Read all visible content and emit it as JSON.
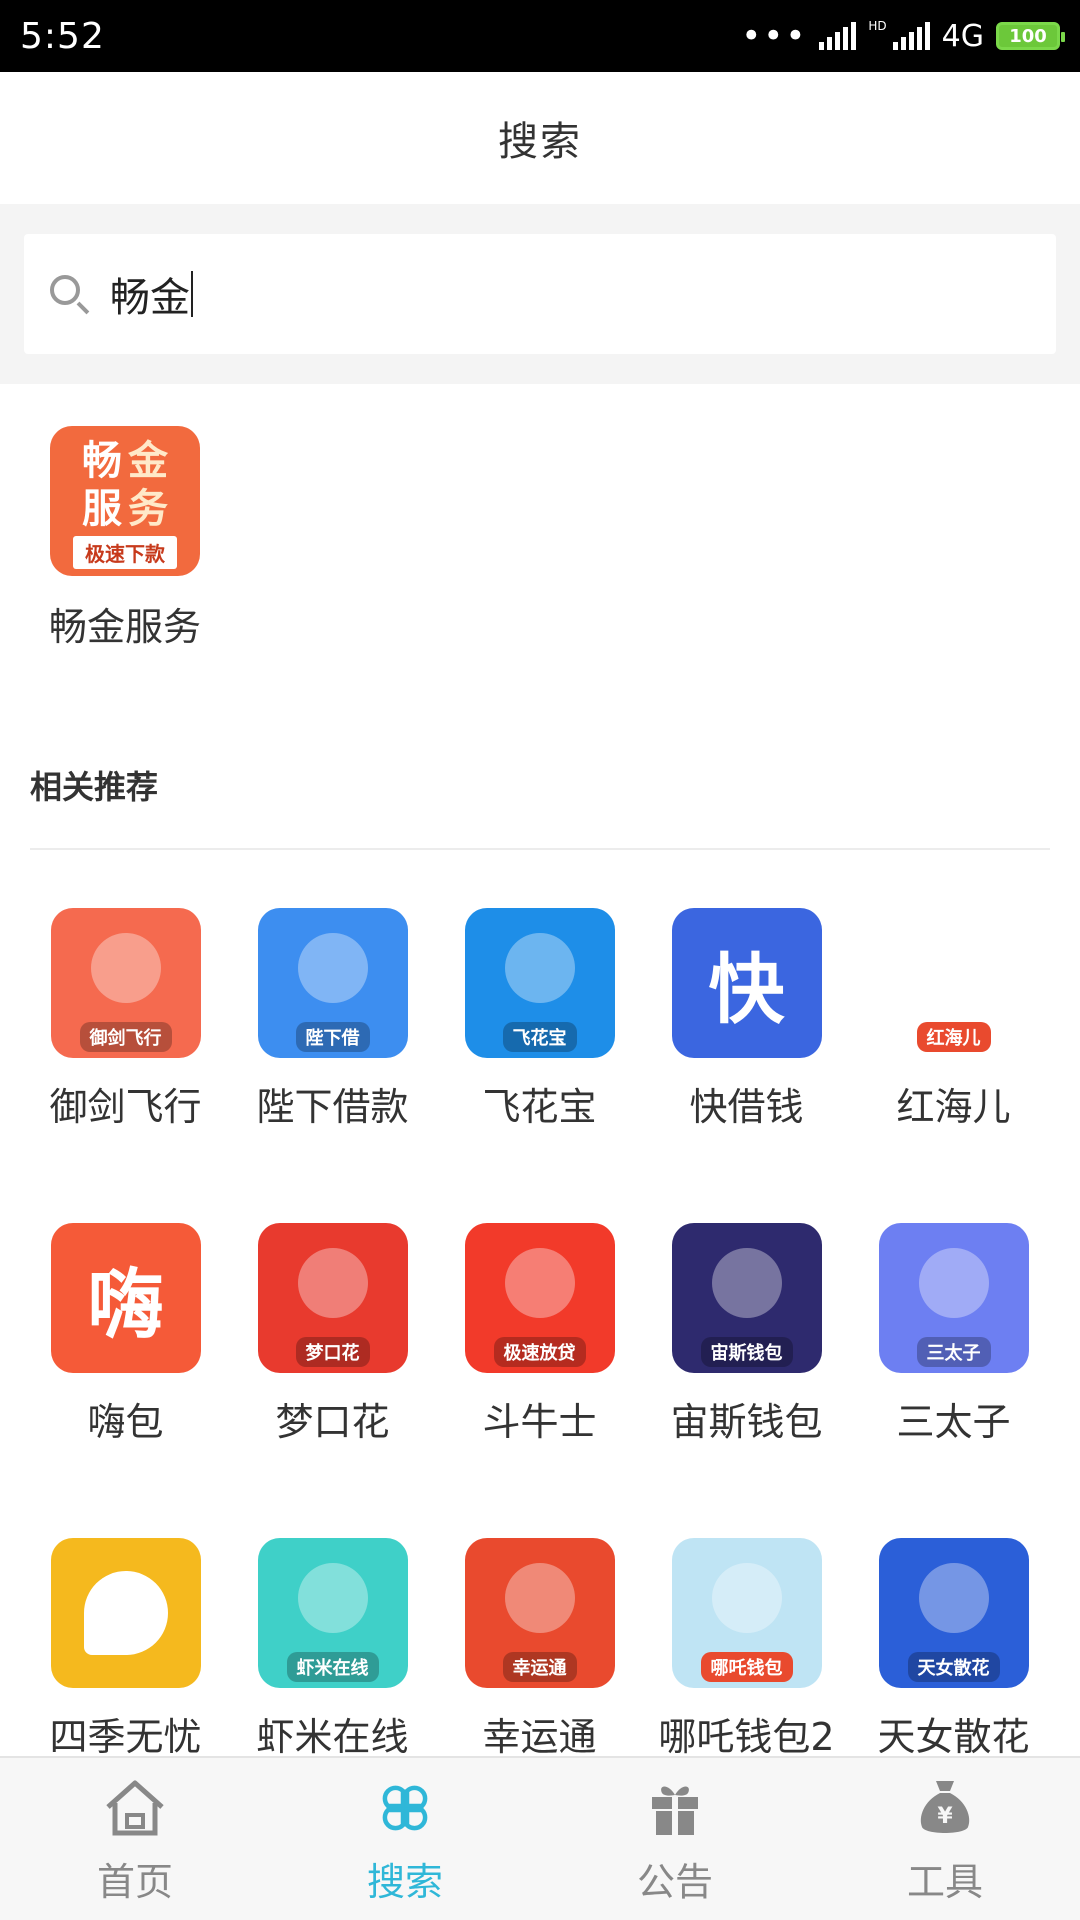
{
  "status_bar": {
    "time": "5:52",
    "network": "4G",
    "battery": "100"
  },
  "header": {
    "title": "搜索"
  },
  "search": {
    "query": "畅金",
    "placeholder": ""
  },
  "result": {
    "name": "畅金服务",
    "icon_chars": [
      "畅",
      "金",
      "服",
      "务"
    ],
    "icon_ribbon": "极速下款"
  },
  "recommend": {
    "title": "相关推荐",
    "apps": [
      {
        "name": "御剑飞行",
        "icon": "sword-warrior-icon",
        "badge": "御剑飞行",
        "bg": "#f56a4f"
      },
      {
        "name": "陛下借款",
        "icon": "king-icon",
        "badge": "陛下借",
        "bg": "#3d8ef0"
      },
      {
        "name": "飞花宝",
        "icon": "pinwheel-icon",
        "badge": "飞花宝",
        "bg": "#1e8ee8"
      },
      {
        "name": "快借钱",
        "icon": "wallet-icon",
        "badge": "快",
        "bg": "#3b66e0"
      },
      {
        "name": "红海儿",
        "icon": "nezha-icon",
        "badge": "红海儿",
        "bg": "#ffffff"
      },
      {
        "name": "嗨包",
        "icon": "hi-bag-icon",
        "badge": "嗨",
        "bg": "#f55a38"
      },
      {
        "name": "梦口花",
        "icon": "red-bag-icon",
        "badge": "梦口花",
        "bg": "#e83a2e"
      },
      {
        "name": "斗牛士",
        "icon": "bull-icon",
        "badge": "极速放贷",
        "bg": "#f23a2a"
      },
      {
        "name": "宙斯钱包",
        "icon": "zeus-icon",
        "badge": "宙斯钱包",
        "bg": "#2e2a6e"
      },
      {
        "name": "三太子",
        "icon": "prince-icon",
        "badge": "三太子",
        "bg": "#6d7ff2"
      },
      {
        "name": "四季无忧",
        "icon": "chat-bubble-icon",
        "badge": "",
        "bg": "#f5b91e"
      },
      {
        "name": "虾米在线",
        "icon": "xiami-icon",
        "badge": "虾米在线",
        "bg": "#3fd0c8"
      },
      {
        "name": "幸运通",
        "icon": "god-of-wealth-icon",
        "badge": "幸运通",
        "bg": "#e94a2e"
      },
      {
        "name": "哪吒钱包2",
        "icon": "nezha-wallet-icon",
        "badge": "哪吒钱包",
        "bg": "#bfe4f4"
      },
      {
        "name": "天女散花",
        "icon": "fairy-icon",
        "badge": "天女散花",
        "bg": "#2b5fd8"
      }
    ]
  },
  "bottom_nav": [
    {
      "label": "首页",
      "icon": "home-icon",
      "active": false
    },
    {
      "label": "搜索",
      "icon": "clover-icon",
      "active": true
    },
    {
      "label": "公告",
      "icon": "gift-icon",
      "active": false
    },
    {
      "label": "工具",
      "icon": "money-bag-icon",
      "active": false
    }
  ],
  "colors": {
    "accent": "#2fb7d8",
    "inactive": "#888888",
    "result_icon": "#f26a3e"
  }
}
